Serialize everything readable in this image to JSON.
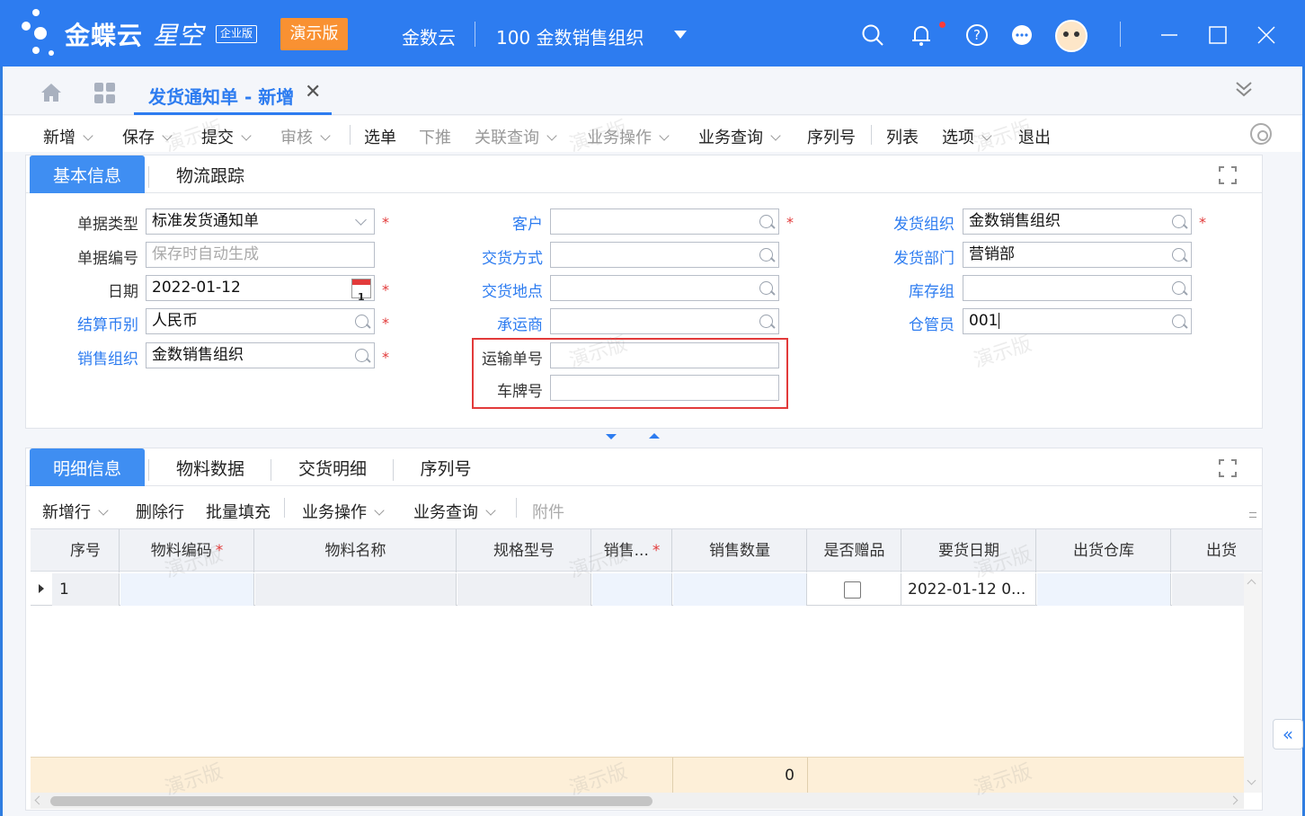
{
  "app": {
    "brand": "金蝶云",
    "brand_sub": "星空",
    "edition": "企业版",
    "demo_label": "演示版",
    "tenant": "金数云",
    "org": "100  金数销售组织"
  },
  "tabs": {
    "document_tab": "发货通知单 - 新增"
  },
  "toolbar": {
    "new": "新增",
    "save": "保存",
    "submit": "提交",
    "audit": "审核",
    "select_order": "选单",
    "push_down": "下推",
    "related_query": "关联查询",
    "business_ops": "业务操作",
    "business_query": "业务查询",
    "serial_number": "序列号",
    "list": "列表",
    "options": "选项",
    "exit": "退出"
  },
  "header_panel": {
    "tabs": [
      "基本信息",
      "物流跟踪"
    ]
  },
  "form": {
    "doc_type_label": "单据类型",
    "doc_type_value": "标准发货通知单",
    "doc_no_label": "单据编号",
    "doc_no_placeholder": "保存时自动生成",
    "date_label": "日期",
    "date_value": "2022-01-12",
    "calendar_day": "1",
    "currency_label": "结算币别",
    "currency_value": "人民币",
    "sales_org_label": "销售组织",
    "sales_org_value": "金数销售组织",
    "customer_label": "客户",
    "customer_value": "",
    "delivery_method_label": "交货方式",
    "delivery_method_value": "",
    "delivery_place_label": "交货地点",
    "delivery_place_value": "",
    "carrier_label": "承运商",
    "carrier_value": "",
    "transport_no_label": "运输单号",
    "transport_no_value": "",
    "plate_no_label": "车牌号",
    "plate_no_value": "",
    "ship_org_label": "发货组织",
    "ship_org_value": "金数销售组织",
    "ship_dept_label": "发货部门",
    "ship_dept_value": "营销部",
    "stock_group_label": "库存组",
    "stock_group_value": "",
    "keeper_label": "仓管员",
    "keeper_value": "001"
  },
  "detail_panel": {
    "tabs": [
      "明细信息",
      "物料数据",
      "交货明细",
      "序列号"
    ],
    "toolbar": {
      "add_row": "新增行",
      "delete_row": "删除行",
      "batch_fill": "批量填充",
      "business_ops": "业务操作",
      "business_query": "业务查询",
      "attachment": "附件"
    },
    "columns": [
      "序号",
      "物料编码",
      "物料名称",
      "规格型号",
      "销售...",
      "销售数量",
      "是否赠品",
      "要货日期",
      "出货仓库",
      "出货"
    ],
    "rows": [
      {
        "seq": "1",
        "material_code": "",
        "material_name": "",
        "spec": "",
        "sales_unit": "",
        "sales_qty": "",
        "is_gift": false,
        "required_date": "2022-01-12 0...",
        "warehouse": "",
        "ship": ""
      }
    ],
    "footer_total": "0"
  },
  "watermark_text": "演示版",
  "colors": {
    "primary": "#2d7cf0",
    "demo_badge": "#f99132",
    "required": "#e23a3a",
    "footer_bg": "#fdefd8"
  }
}
